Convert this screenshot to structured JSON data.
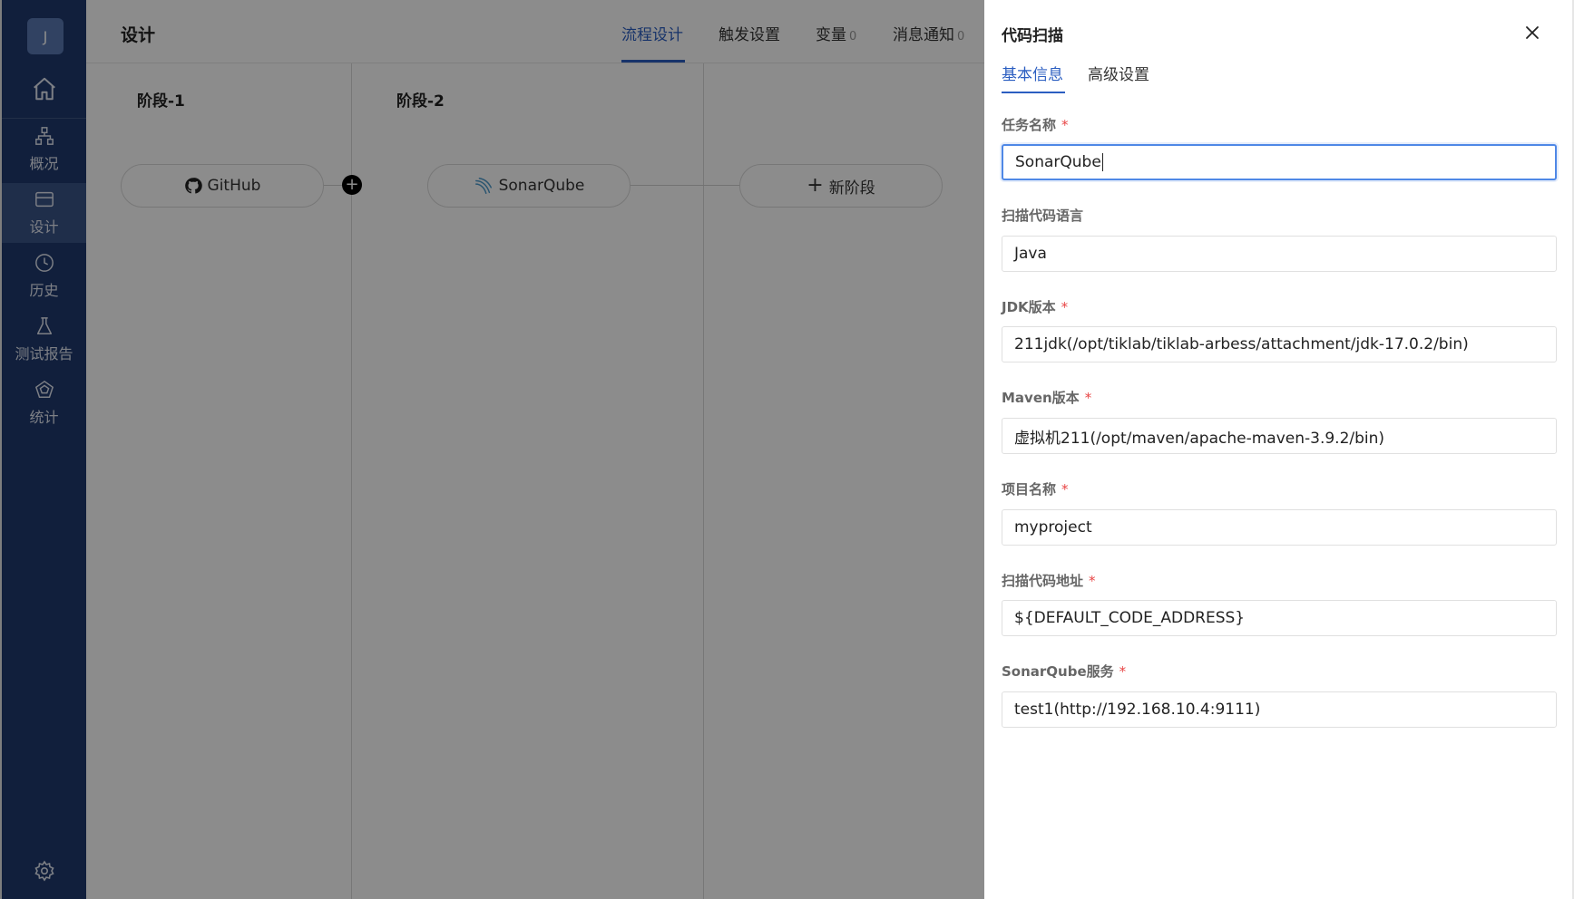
{
  "sidebar": {
    "avatar_letter": "J",
    "items": [
      {
        "label": "概况",
        "icon": "overview-icon"
      },
      {
        "label": "设计",
        "icon": "design-icon",
        "active": true
      },
      {
        "label": "历史",
        "icon": "history-icon"
      },
      {
        "label": "测试报告",
        "icon": "test-report-icon"
      },
      {
        "label": "统计",
        "icon": "statistics-icon"
      }
    ]
  },
  "header": {
    "title": "设计",
    "tabs": [
      {
        "label": "流程设计",
        "active": true
      },
      {
        "label": "触发设置"
      },
      {
        "label": "变量",
        "count": "0"
      },
      {
        "label": "消息通知",
        "count": "0"
      }
    ]
  },
  "pipeline": {
    "stages": [
      {
        "title": "阶段-1",
        "task": "GitHub"
      },
      {
        "title": "阶段-2",
        "task": "SonarQube"
      }
    ],
    "add_stage_label": "新阶段"
  },
  "drawer": {
    "title": "代码扫描",
    "tabs": [
      {
        "label": "基本信息",
        "active": true
      },
      {
        "label": "高级设置"
      }
    ],
    "fields": [
      {
        "label": "任务名称",
        "required": true,
        "value": "SonarQube"
      },
      {
        "label": "扫描代码语言",
        "required": false,
        "value": "Java"
      },
      {
        "label": "JDK版本",
        "required": true,
        "value": "211jdk(/opt/tiklab/tiklab-arbess/attachment/jdk-17.0.2/bin)"
      },
      {
        "label": "Maven版本",
        "required": true,
        "value": "虚拟机211(/opt/maven/apache-maven-3.9.2/bin)"
      },
      {
        "label": "项目名称",
        "required": true,
        "value": "myproject"
      },
      {
        "label": "扫描代码地址",
        "required": true,
        "value": "${DEFAULT_CODE_ADDRESS}"
      },
      {
        "label": "SonarQube服务",
        "required": true,
        "value": "test1(http://192.168.10.4:9111)"
      }
    ],
    "required_mark": "*"
  },
  "colors": {
    "sidebar_bg": "#1f3a6e",
    "accent": "#2b5ec1",
    "required": "#e84545"
  }
}
